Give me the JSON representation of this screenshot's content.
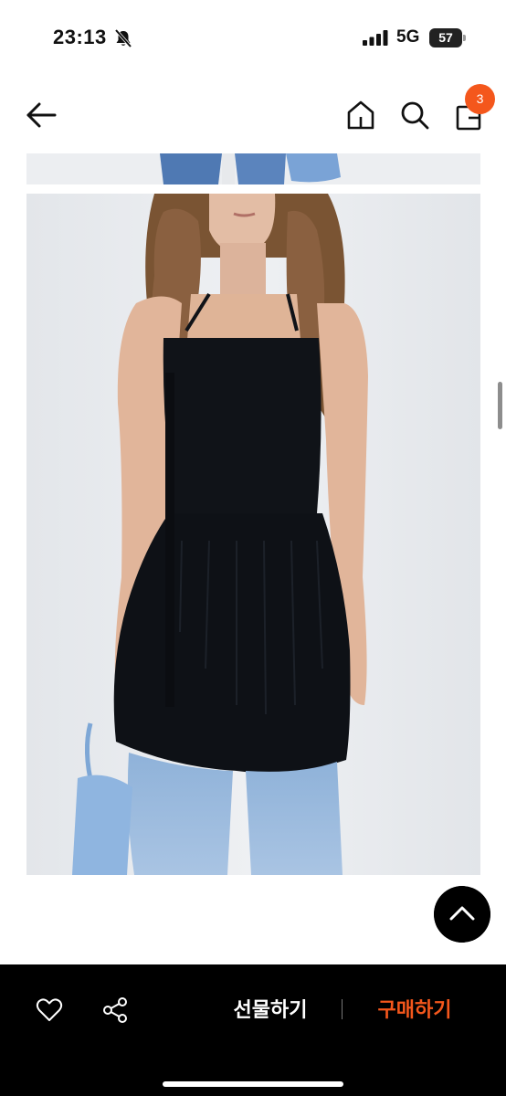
{
  "status_bar": {
    "time": "23:13",
    "network": "5G",
    "battery": "57"
  },
  "nav": {
    "back_icon": "arrow-left-icon",
    "home_icon": "home-icon",
    "search_icon": "search-icon",
    "bag_icon": "shopping-bag-icon",
    "cart_count": "3"
  },
  "colors": {
    "accent": "#f4571c",
    "bottom_bar": "#000000"
  },
  "bottom_bar": {
    "like_icon": "heart-icon",
    "share_icon": "share-icon",
    "gift_label": "선물하기",
    "buy_label": "구매하기"
  }
}
